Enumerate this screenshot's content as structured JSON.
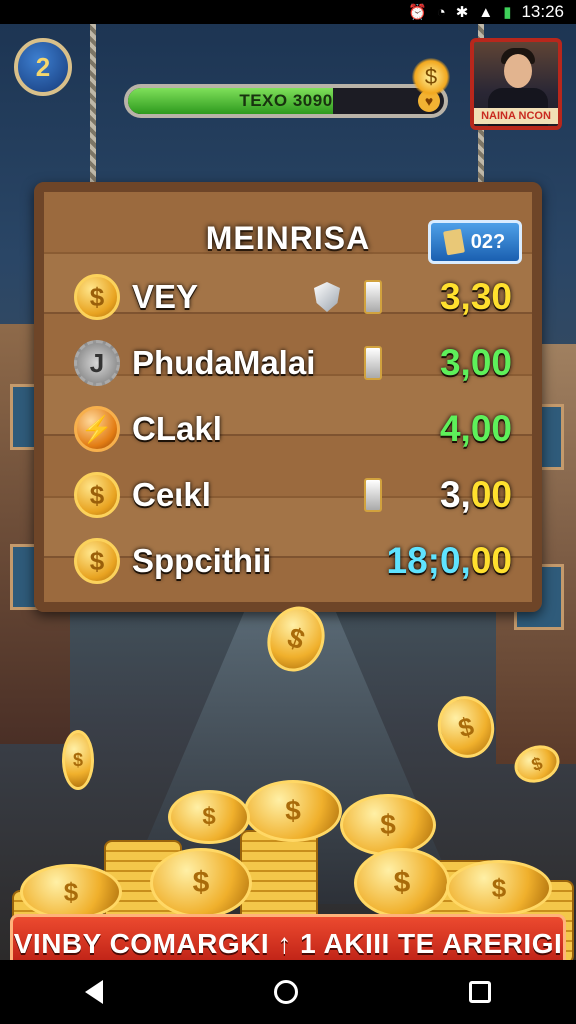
{
  "status_bar": {
    "time": "13:26",
    "icons": [
      "alarm-icon",
      "wifi-icon",
      "bluetooth-icon",
      "signal-icon",
      "battery-icon"
    ]
  },
  "hud": {
    "level": "2",
    "xp_text": "TEXO 3090",
    "xp_progress": 0.65,
    "avatar_label": "NAINA NCON"
  },
  "board": {
    "title": "MEINRISA",
    "ticket_value": "02?",
    "rows": [
      {
        "icon": "dollar-coin-icon",
        "name": "VEY",
        "value": "3,30",
        "color": "#ffe02e"
      },
      {
        "icon": "gear-coin-icon",
        "name": "PhudaMalai",
        "value": "3,00",
        "color": "#5ef05a"
      },
      {
        "icon": "bolt-coin-icon",
        "name": "CLakl",
        "value": "4,00",
        "color": "#5ef05a"
      },
      {
        "icon": "dollar-coin-icon",
        "name": "Ceιkl",
        "value_a": "3,",
        "value_b": "00"
      },
      {
        "icon": "dollar-coin-icon",
        "name": "Sppcithii",
        "value_a": "18;0,",
        "value_b": "00"
      }
    ]
  },
  "cta": {
    "label": "VINBY COMARGKI ↑ 1  AKIII TE ARERIGI"
  },
  "colors": {
    "accent_red": "#c92a20",
    "gold": "#f0b02c",
    "wood": "#8a5c33"
  }
}
